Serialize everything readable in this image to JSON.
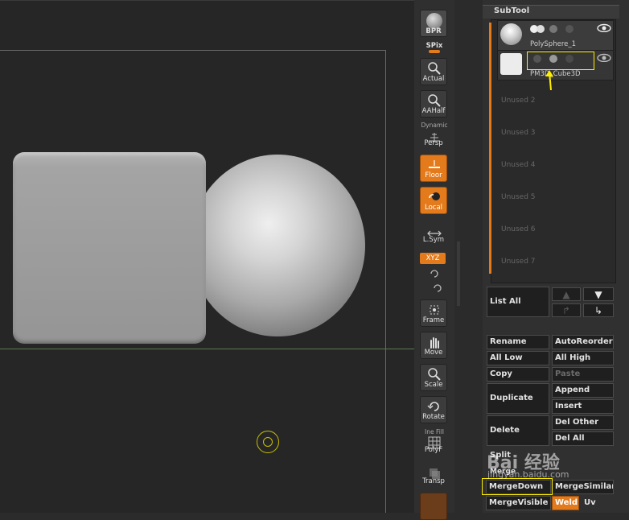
{
  "colors": {
    "accent_orange": "#e37a1c",
    "highlight_yellow": "#ffee00",
    "viewport_bg": "#262626",
    "panel_bg": "#303030"
  },
  "shelf": {
    "bpr": "BPR",
    "spix": "SPix",
    "actual": "Actual",
    "aahalf": "AAHalf",
    "dynamic": "Dynamic",
    "persp": "Persp",
    "floor": "Floor",
    "local": "Local",
    "lsym": "L.Sym",
    "xyz": "XYZ",
    "frame": "Frame",
    "move": "Move",
    "scale": "Scale",
    "rotate": "Rotate",
    "line_fill": "Ine Fill",
    "polyf": "PolyF",
    "transp": "Transp"
  },
  "subtool": {
    "title": "SubTool",
    "items": [
      {
        "name": "PolySphere_1",
        "thumb": "sphere"
      },
      {
        "name": "PM3D_Cube3D",
        "thumb": "cube"
      }
    ],
    "unused": [
      "Unused 2",
      "Unused 3",
      "Unused 4",
      "Unused 5",
      "Unused 6",
      "Unused 7"
    ]
  },
  "buttons": {
    "list_all": "List All",
    "rename": "Rename",
    "auto_reorder": "AutoReorder",
    "all_low": "All Low",
    "all_high": "All High",
    "copy": "Copy",
    "paste": "Paste",
    "duplicate": "Duplicate",
    "append": "Append",
    "insert": "Insert",
    "delete": "Delete",
    "del_other": "Del Other",
    "del_all": "Del All",
    "split": "Split",
    "merge": "Merge",
    "merge_down": "MergeDown",
    "merge_similar": "MergeSimilar",
    "merge_visible": "MergeVisible",
    "weld": "Weld",
    "uv": "Uv"
  },
  "watermark": {
    "text": "Bai 经验",
    "url": "jingyan.baidu.com"
  }
}
